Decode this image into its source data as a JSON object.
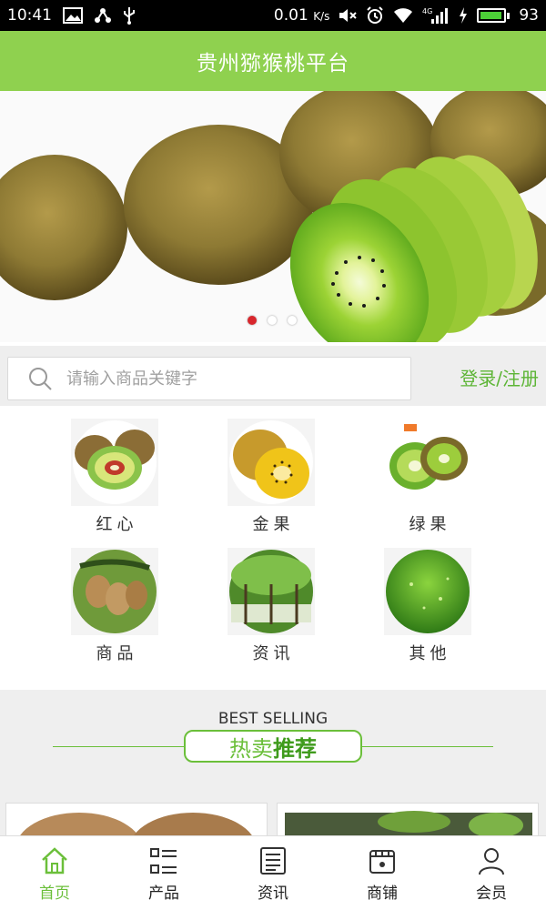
{
  "status_bar": {
    "time": "10:41",
    "net_speed": "0.01",
    "net_unit": "K/s",
    "network": "4G",
    "battery": "93",
    "battery_level": 0.93
  },
  "header": {
    "title": "贵州猕猴桃平台"
  },
  "banner": {
    "slide_count": 3,
    "active_slide": 0
  },
  "search": {
    "placeholder": "请输入商品关键字",
    "login_label": "登录/注册"
  },
  "categories": [
    {
      "label": "红心",
      "icon": "red-heart-kiwi-image"
    },
    {
      "label": "金果",
      "icon": "golden-kiwi-image"
    },
    {
      "label": "绿果",
      "icon": "green-kiwi-image"
    },
    {
      "label": "商品",
      "icon": "kiwi-products-image"
    },
    {
      "label": "资讯",
      "icon": "kiwi-orchard-image"
    },
    {
      "label": "其他",
      "icon": "green-bokeh-image"
    }
  ],
  "best_selling": {
    "english": "BEST SELLING",
    "title_a": "热卖",
    "title_b": "推荐"
  },
  "tabbar": [
    {
      "label": "首页",
      "icon": "home-icon",
      "active": true
    },
    {
      "label": "产品",
      "icon": "list-icon",
      "active": false
    },
    {
      "label": "资讯",
      "icon": "news-icon",
      "active": false
    },
    {
      "label": "商铺",
      "icon": "store-icon",
      "active": false
    },
    {
      "label": "会员",
      "icon": "user-icon",
      "active": false
    }
  ],
  "colors": {
    "brand_green": "#8fd14f",
    "accent_green": "#6bbf3a",
    "dot_active": "#d8262c"
  }
}
